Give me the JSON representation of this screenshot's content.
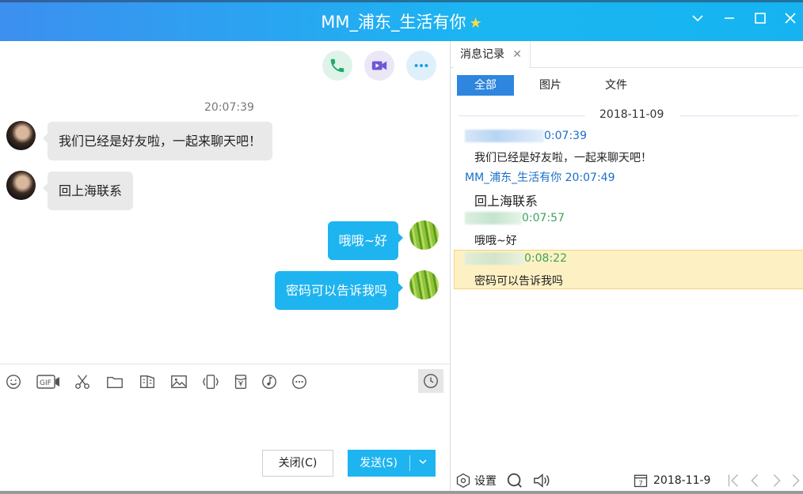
{
  "window": {
    "title": "MM_浦东_生活有你",
    "controls": [
      "chevron-down",
      "minimize",
      "maximize",
      "close"
    ]
  },
  "chat": {
    "time": "20:07:39",
    "messages": [
      {
        "side": "in",
        "text": "我们已经是好友啦，一起来聊天吧！"
      },
      {
        "side": "in",
        "text": "回上海联系"
      },
      {
        "side": "out",
        "text": "哦哦~好"
      },
      {
        "side": "out",
        "text": "密码可以告诉我吗"
      }
    ],
    "call_buttons": [
      "phone-icon",
      "video-icon",
      "more-icon"
    ]
  },
  "toolbar": {
    "gif_label": "GIF",
    "icons": [
      "emoji-icon",
      "gif-icon",
      "scissors-icon",
      "folder-icon",
      "doc-icon",
      "image-icon",
      "shake-icon",
      "redpacket-icon",
      "music-icon",
      "more-icon",
      "history-clock-icon"
    ]
  },
  "actions": {
    "close_label": "关闭(C)",
    "send_label": "发送(S)"
  },
  "history": {
    "tab_label": "消息记录",
    "filters": [
      "全部",
      "图片",
      "文件"
    ],
    "date": "2018-11-09",
    "entries": [
      {
        "time": "0:07:39",
        "text": "我们已经是好友啦，一起来聊天吧！",
        "color": "#1a6fc9"
      },
      {
        "sender": "MM_浦东_生活有你 20:07:49",
        "text": "回上海联系",
        "color": "#1a6fc9"
      },
      {
        "time": "0:07:57",
        "text": "哦哦~好",
        "color": "#3aa35a"
      },
      {
        "time": "0:08:22",
        "text": "密码可以告诉我吗",
        "color": "#3aa35a"
      }
    ],
    "footer": {
      "settings_label": "设置",
      "date_label": "2018-11-9",
      "calendar_day": "7"
    }
  },
  "colors": {
    "accent": "#1eb4f0",
    "title_gradient_start": "#3d8ff0",
    "highlight": "#fdf1c4"
  }
}
